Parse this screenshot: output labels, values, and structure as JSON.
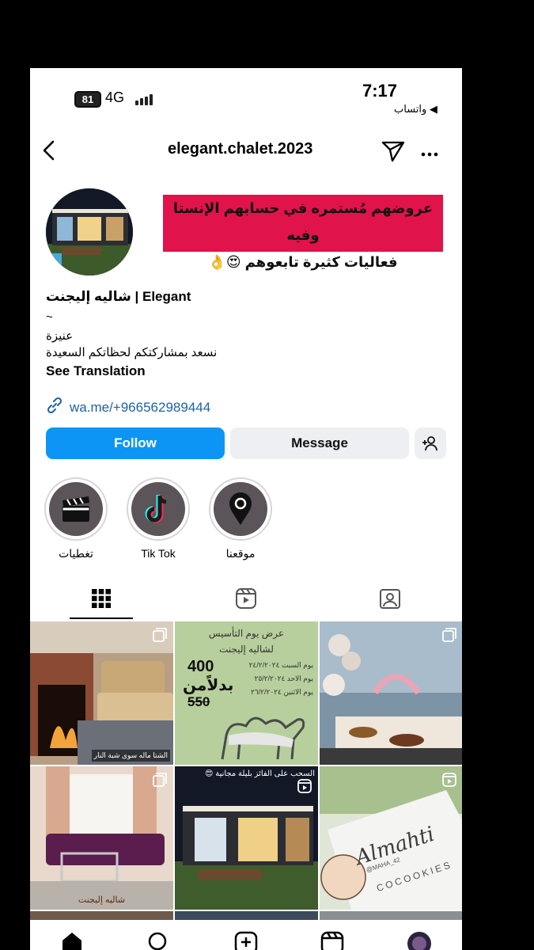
{
  "status_bar": {
    "battery": "81",
    "network": "4G",
    "time": "7:17",
    "back_app": "◀ واتساب"
  },
  "header": {
    "username": "elegant.chalet.2023",
    "icons": [
      "back-arrow-icon",
      "send-icon",
      "more-icon"
    ]
  },
  "banner": {
    "line1": "عروضهم مُستمره في حسابهم الإنستا وفيه",
    "line2": "فعاليات كثيرة تابعوهم 😍👌"
  },
  "profile": {
    "name": "شاليه إليجنت | Elegant",
    "tilde": "~",
    "location": "عنيزة",
    "bio": "نسعد بمشاركتكم لحظاتكم السعيدة",
    "see_translation": "See Translation",
    "link": "wa.me/+966562989444"
  },
  "actions": {
    "follow": "Follow",
    "message": "Message"
  },
  "highlights": [
    {
      "label": "تغطيات",
      "icon": "clapperboard-icon"
    },
    {
      "label": "Tik Tok",
      "icon": "tiktok-icon"
    },
    {
      "label": "موقعنا",
      "icon": "location-pin-icon"
    }
  ],
  "tabs": [
    "grid-icon",
    "reels-icon",
    "tagged-icon"
  ],
  "posts": [
    {
      "caption": "الشتا ماله سوى شبة النار",
      "icon": "multi-post-icon"
    },
    {
      "title": "عرض يوم التأسيس",
      "subtitle": "لشاليه إليجنت",
      "price_new": "400",
      "price_label": "بدلاًمن",
      "price_old": "550",
      "lines": [
        "يوم السبت ٢٤/٢/٢٠٢٤",
        "يوم الاحد ٢٥/٢/٢٠٢٤",
        "يوم الاثنين ٢٦/٢/٢٠٢٤"
      ]
    },
    {
      "icon": "multi-post-icon"
    },
    {
      "caption": "شاليه إليجنت",
      "icon": "multi-post-icon"
    },
    {
      "caption": "السحب على الفائز بليلة مجانية 😍",
      "icon": "reel-icon"
    },
    {
      "brand": "Almahti",
      "brand_sub": "COCOOKIES",
      "handle": "@MAHA_42",
      "icon": "reel-icon"
    }
  ],
  "bottom_nav": [
    "home-icon",
    "search-icon",
    "new-post-icon",
    "reels-icon",
    "profile-avatar"
  ],
  "colors": {
    "follow": "#0d95f6",
    "banner": "#e0134a",
    "link": "#1d62a8",
    "post_green": "#b7cf9c"
  }
}
